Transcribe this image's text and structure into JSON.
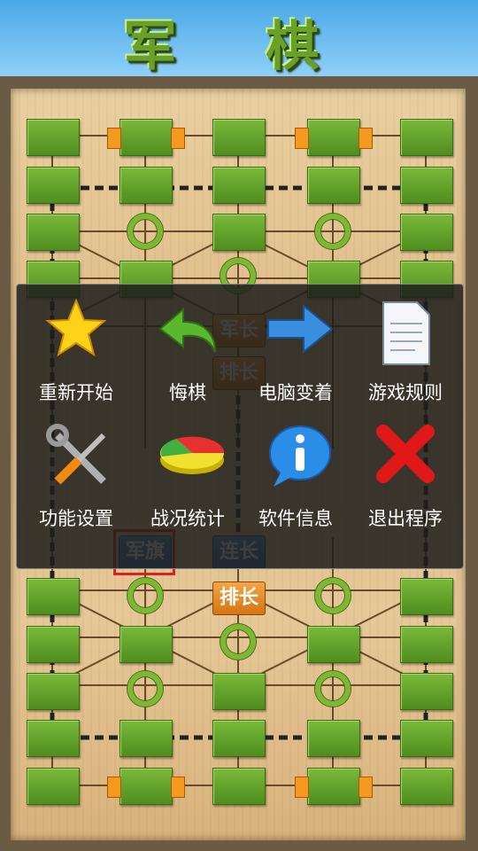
{
  "title": "军 棋",
  "menu": {
    "items": [
      {
        "label": "重新开始",
        "icon": "star-icon"
      },
      {
        "label": "悔棋",
        "icon": "undo-arrow-icon"
      },
      {
        "label": "电脑变着",
        "icon": "right-arrow-icon"
      },
      {
        "label": "游戏规则",
        "icon": "document-icon"
      },
      {
        "label": "功能设置",
        "icon": "tools-icon"
      },
      {
        "label": "战况统计",
        "icon": "pie-chart-icon"
      },
      {
        "label": "软件信息",
        "icon": "info-icon"
      },
      {
        "label": "退出程序",
        "icon": "exit-x-icon"
      }
    ]
  },
  "pieces": {
    "top_junzhang": "军长",
    "top_paizhang": "排长",
    "bottom_junqi": "军旗",
    "bottom_lianzhang": "连长",
    "bottom_paizhang": "排长"
  },
  "colors": {
    "sky": "#4aa8e8",
    "station_green": "#5f9f28",
    "piece_orange": "#e8881e",
    "piece_blue": "#2a62b0",
    "selection_red": "#e02020"
  }
}
